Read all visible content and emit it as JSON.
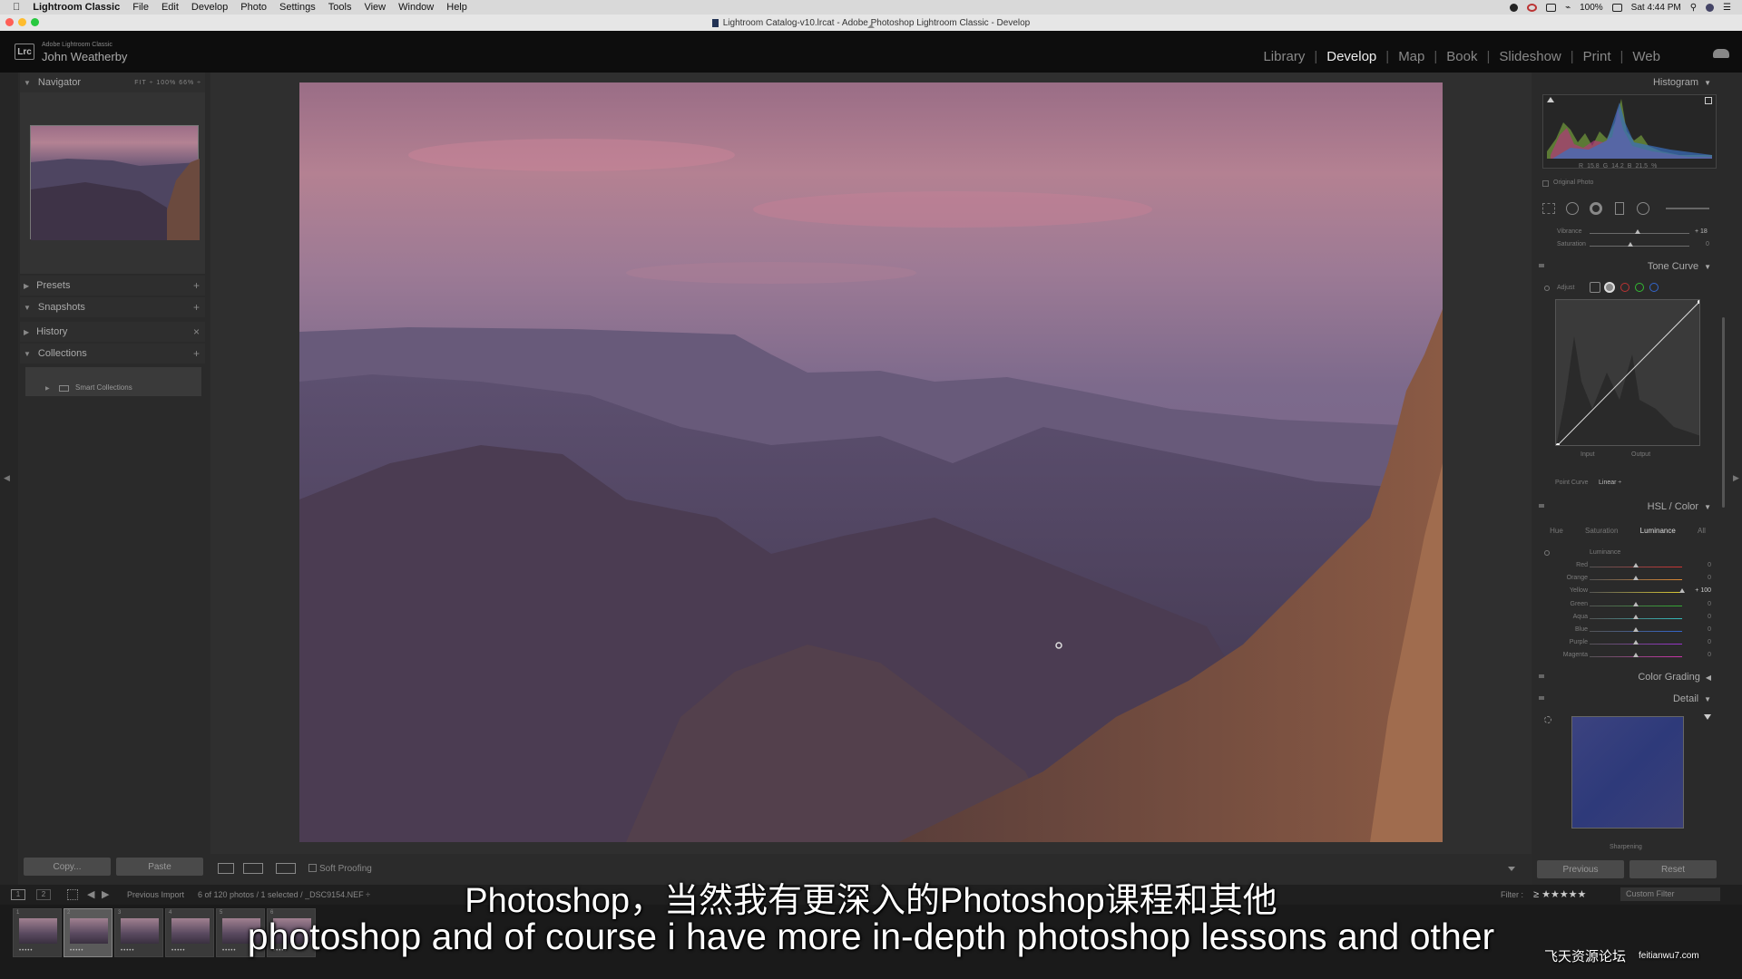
{
  "menubar": {
    "app": "Lightroom Classic",
    "items": [
      "File",
      "Edit",
      "Develop",
      "Photo",
      "Settings",
      "Tools",
      "View",
      "Window",
      "Help"
    ],
    "battery": "100%",
    "clock": "Sat 4:44 PM"
  },
  "window": {
    "title": "Lightroom Catalog-v10.lrcat - Adobe Photoshop Lightroom Classic - Develop"
  },
  "identity": {
    "logo": "Lrc",
    "product": "Adobe Lightroom Classic",
    "user": "John Weatherby"
  },
  "modules": {
    "items": [
      "Library",
      "Develop",
      "Map",
      "Book",
      "Slideshow",
      "Print",
      "Web"
    ],
    "active": "Develop"
  },
  "left_panel": {
    "navigator": {
      "label": "Navigator",
      "zoom_options": "FIT ÷  100%  66%  ÷"
    },
    "presets": "Presets",
    "snapshots": "Snapshots",
    "history": "History",
    "collections": "Collections",
    "smart_collections": "Smart Collections",
    "copy_label": "Copy...",
    "paste_label": "Paste"
  },
  "toolbar": {
    "soft_proofing": "Soft Proofing"
  },
  "right_panel": {
    "histogram": {
      "label": "Histogram",
      "r_label": "R",
      "r": "15.8",
      "g_label": "G",
      "g": "14.2",
      "b_label": "B",
      "b": "21.5",
      "pct": "%",
      "original_photo": "Original Photo"
    },
    "basic": {
      "vibrance_label": "Vibrance",
      "vibrance": "+ 18",
      "saturation_label": "Saturation",
      "saturation": "0"
    },
    "tone_curve": {
      "label": "Tone Curve",
      "adjust": "Adjust",
      "input": "Input",
      "output": "Output",
      "point_curve_label": "Point Curve",
      "point_curve_value": "Linear ÷"
    },
    "hsl": {
      "label": "HSL / Color",
      "tabs": [
        "Hue",
        "Saturation",
        "Luminance",
        "All"
      ],
      "active_tab": "Luminance",
      "section": "Luminance",
      "rows": [
        {
          "name": "Red",
          "value": "0",
          "level": 0
        },
        {
          "name": "Orange",
          "value": "0",
          "level": 0
        },
        {
          "name": "Yellow",
          "value": "+ 100",
          "level": 100
        },
        {
          "name": "Green",
          "value": "0",
          "level": 0
        },
        {
          "name": "Aqua",
          "value": "0",
          "level": 0
        },
        {
          "name": "Blue",
          "value": "0",
          "level": 0
        },
        {
          "name": "Purple",
          "value": "0",
          "level": 0
        },
        {
          "name": "Magenta",
          "value": "0",
          "level": 0
        }
      ]
    },
    "color_grading": "Color Grading",
    "detail": {
      "label": "Detail",
      "sharpening": "Sharpening"
    },
    "previous_label": "Previous",
    "reset_label": "Reset"
  },
  "filmstrip": {
    "page1": "1",
    "page2": "2",
    "source": "Previous Import",
    "info": "6 of 120 photos / 1 selected / _DSC9154.NEF ÷",
    "filter_label": "Filter :",
    "filter_stars": "≥ ★★★★★",
    "filter_value": "Custom Filter",
    "thumbs": [
      "1",
      "2",
      "3",
      "4",
      "5",
      "6"
    ]
  },
  "subtitles": {
    "cn": "Photoshop，当然我有更深入的Photoshop课程和其他",
    "en": "photoshop and of course i have more in-depth photoshop lessons and other"
  },
  "watermark": {
    "cn": "飞天资源论坛",
    "url": "feitianwu7.com"
  },
  "colors": {
    "accent": "#eeeeee",
    "panel": "#2a2a2a",
    "background": "#2f2f2f"
  }
}
